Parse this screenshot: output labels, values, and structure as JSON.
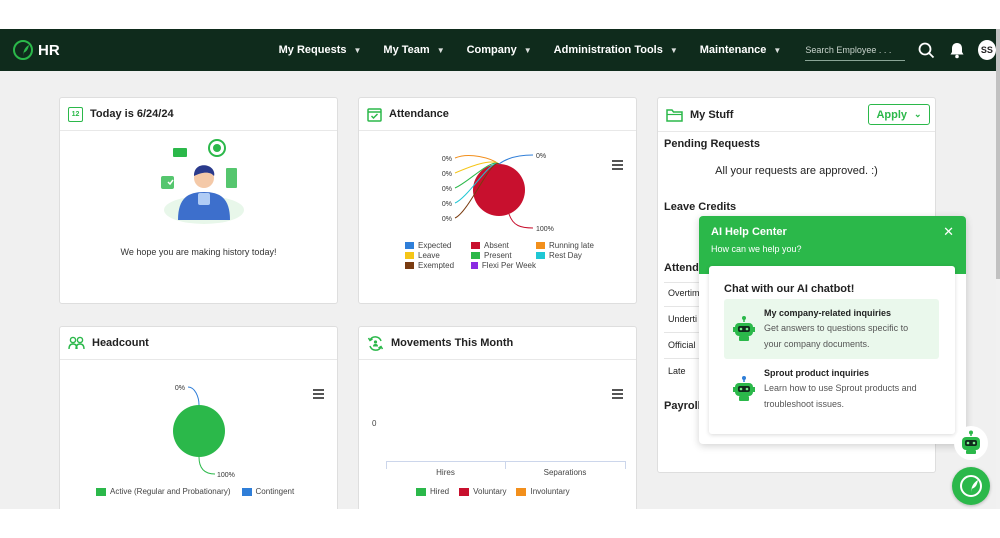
{
  "brand": {
    "name": "HR"
  },
  "nav": {
    "items": [
      {
        "label": "My Requests"
      },
      {
        "label": "My Team"
      },
      {
        "label": "Company"
      },
      {
        "label": "Administration Tools"
      },
      {
        "label": "Maintenance"
      }
    ],
    "search_placeholder": "Search Employee . . .",
    "avatar_initials": "SS"
  },
  "today": {
    "title": "Today is 6/24/24",
    "calendar_day": "12",
    "message": "We hope you are making history today!"
  },
  "attendance": {
    "title": "Attendance",
    "labels": [
      "0%",
      "0%",
      "0%",
      "0%",
      "0%",
      "0%",
      "0%",
      "100%"
    ],
    "legend": [
      {
        "label": "Expected",
        "color": "#2f7ed8"
      },
      {
        "label": "Absent",
        "color": "#c8102e"
      },
      {
        "label": "Running late",
        "color": "#f28f1c"
      },
      {
        "label": "Leave",
        "color": "#f5c518"
      },
      {
        "label": "Present",
        "color": "#2bb84a"
      },
      {
        "label": "Rest Day",
        "color": "#1fc7d4"
      },
      {
        "label": "Exempted",
        "color": "#7a3b10"
      },
      {
        "label": "Flexi Per Week",
        "color": "#8a2be2"
      }
    ]
  },
  "headcount": {
    "title": "Headcount",
    "label_top": "0%",
    "label_bottom": "100%",
    "legend": [
      {
        "label": "Active (Regular and Probationary)",
        "color": "#2bb84a"
      },
      {
        "label": "Contingent",
        "color": "#2f7ed8"
      }
    ]
  },
  "movements": {
    "title": "Movements This Month",
    "y_tick": "0",
    "categories": [
      "Hires",
      "Separations"
    ],
    "legend": [
      {
        "label": "Hired",
        "color": "#2bb84a"
      },
      {
        "label": "Voluntary",
        "color": "#c8102e"
      },
      {
        "label": "Involuntary",
        "color": "#f28f1c"
      }
    ]
  },
  "mystuff": {
    "title": "My Stuff",
    "apply_label": "Apply",
    "pending_title": "Pending Requests",
    "pending_msg": "All your requests are approved. :)",
    "leave_title": "Leave Credits",
    "attendance_partial": "Attenda",
    "rows": [
      "Overtim",
      "Underti",
      "Official",
      "Late"
    ],
    "payroll_partial": "Payroll"
  },
  "help": {
    "title": "AI Help Center",
    "subtitle": "How can we help you?",
    "chat_title": "Chat with our AI chatbot!",
    "options": [
      {
        "title": "My company-related inquiries",
        "desc1": "Get answers to questions specific to",
        "desc2": "your company documents.",
        "highlight": "#eaf8ec"
      },
      {
        "title": "Sprout product inquiries",
        "desc1": "Learn how to use Sprout products and",
        "desc2": "troubleshoot issues.",
        "highlight": "#ffffff"
      }
    ]
  },
  "chart_data": [
    {
      "type": "pie",
      "title": "Attendance",
      "categories": [
        "Expected",
        "Absent",
        "Running late",
        "Leave",
        "Present",
        "Rest Day",
        "Exempted",
        "Flexi Per Week"
      ],
      "values": [
        0,
        100,
        0,
        0,
        0,
        0,
        0,
        0
      ],
      "unit": "%"
    },
    {
      "type": "pie",
      "title": "Headcount",
      "categories": [
        "Active (Regular and Probationary)",
        "Contingent"
      ],
      "values": [
        100,
        0
      ],
      "unit": "%"
    },
    {
      "type": "bar",
      "title": "Movements This Month",
      "categories": [
        "Hires",
        "Separations"
      ],
      "series": [
        {
          "name": "Hired",
          "values": [
            0,
            0
          ]
        },
        {
          "name": "Voluntary",
          "values": [
            0,
            0
          ]
        },
        {
          "name": "Involuntary",
          "values": [
            0,
            0
          ]
        }
      ],
      "y_ticks": [
        "0"
      ]
    }
  ]
}
